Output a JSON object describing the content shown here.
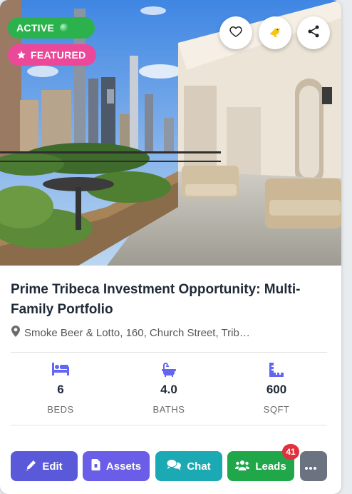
{
  "status_badge": "ACTIVE",
  "featured_badge": "FEATURED",
  "listing": {
    "title": "Prime Tribeca Investment Opportunity: Multi-Family Portfolio",
    "address": "Smoke Beer & Lotto, 160, Church Street, Trib…"
  },
  "stats": {
    "beds": {
      "value": "6",
      "label": "BEDS"
    },
    "baths": {
      "value": "4.0",
      "label": "BATHS"
    },
    "sqft": {
      "value": "600",
      "label": "SQFT"
    }
  },
  "actions": {
    "edit": "Edit",
    "assets": "Assets",
    "chat": "Chat",
    "leads": "Leads",
    "leads_count": "41"
  },
  "colors": {
    "active": "#2bb24c",
    "featured": "#ec4899",
    "edit": "#5a59d9",
    "assets": "#6a5de8",
    "chat": "#1ba9b3",
    "leads": "#20a74a",
    "more": "#6b7280",
    "stat_icon": "#6366f1"
  },
  "icons": [
    "heart-icon",
    "bird-icon",
    "share-icon",
    "star-icon",
    "map-marker-icon",
    "bed-icon",
    "bath-icon",
    "ruler-icon",
    "pencil-icon",
    "file-icon",
    "comments-icon",
    "users-icon",
    "ellipsis-icon"
  ]
}
